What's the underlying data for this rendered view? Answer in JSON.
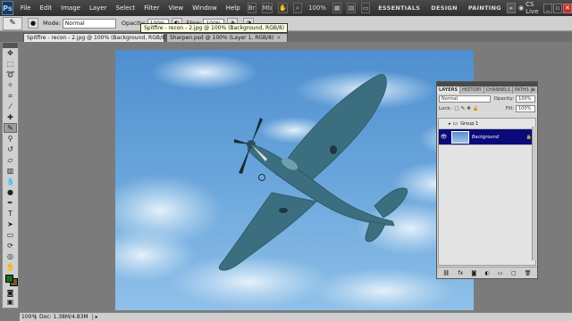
{
  "menubar": {
    "logo": "Ps",
    "items": [
      "File",
      "Edit",
      "Image",
      "Layer",
      "Select",
      "Filter",
      "View",
      "Window",
      "Help"
    ],
    "zoom": "100%",
    "workspaces": [
      "ESSENTIALS",
      "DESIGN",
      "PAINTING"
    ],
    "more": "»",
    "cs_live": "CS Live"
  },
  "options": {
    "mode_label": "Mode:",
    "mode_value": "Normal",
    "opacity_label": "Opacity:",
    "opacity_value": "100%",
    "flow_label": "Flow:",
    "flow_value": "100%"
  },
  "tabs": [
    {
      "label": "Spitfire - recon - 2.jpg @ 100% (Background, RGB/8)"
    },
    {
      "label": "Sharpen.psd @ 100% (Layer 1, RGB/8)"
    }
  ],
  "tooltip": "Spitfire - recon - 2.jpg @ 100% (Background, RGB/8)",
  "status": {
    "zoom": "100%",
    "doc": "Doc: 1.38M/4.83M"
  },
  "layers_panel": {
    "tabs": [
      "LAYERS",
      "HISTORY",
      "CHANNELS",
      "PATHS"
    ],
    "blend": "Normal",
    "opacity_label": "Opacity:",
    "opacity_value": "100%",
    "lock_label": "Lock:",
    "fill_label": "Fill:",
    "fill_value": "100%",
    "layers": [
      {
        "name": "Group 1"
      },
      {
        "name": "Background"
      }
    ]
  }
}
